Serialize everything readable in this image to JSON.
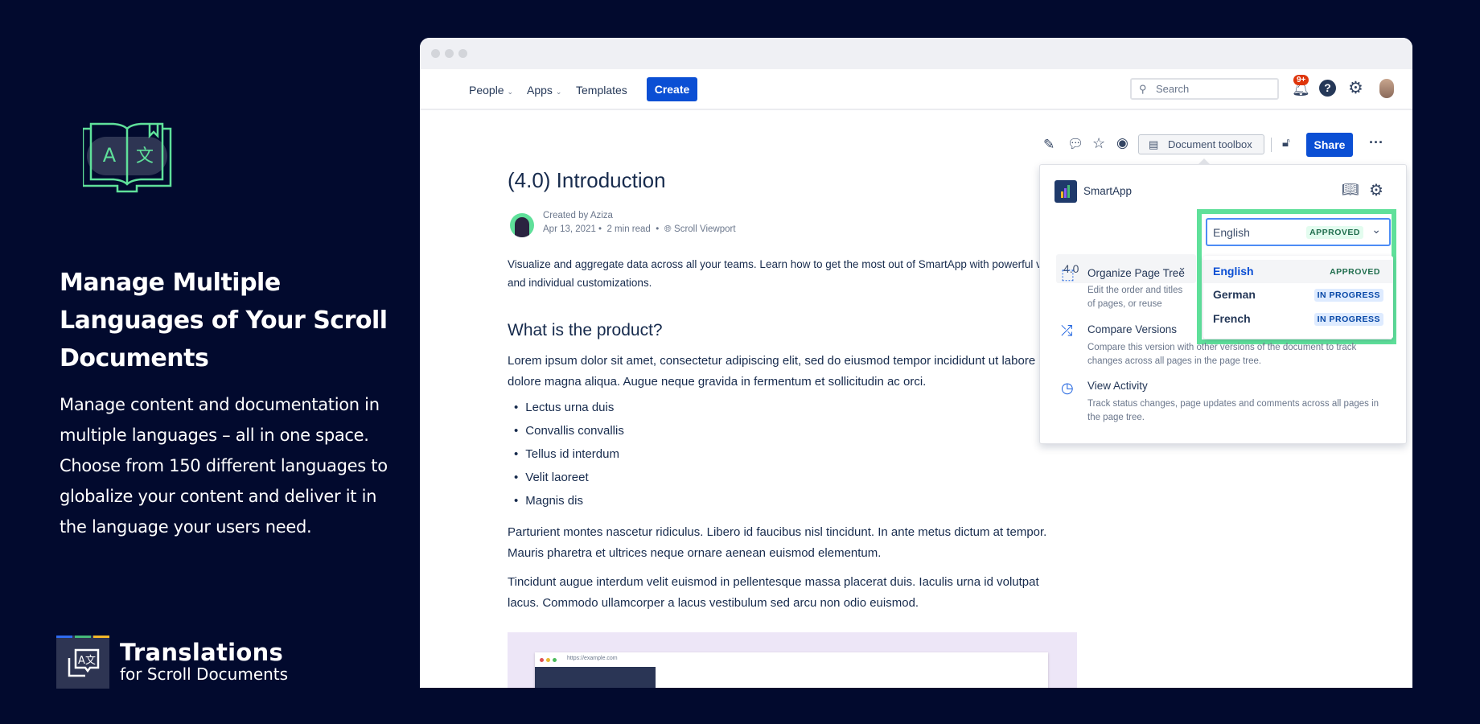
{
  "hero": {
    "heading": "Manage Multiple Languages of Your Scroll Documents",
    "body": "Manage content and documentation in multiple languages – all in one space. Choose from 150 different languages to globalize your content and deliver it in the language your users need."
  },
  "brand": {
    "title": "Translations",
    "subtitle": "for Scroll Documents",
    "icon_text": "A文",
    "colors": [
      "#2f6bf0",
      "#45b979",
      "#f5b829"
    ]
  },
  "nav": {
    "people": "People",
    "apps": "Apps",
    "templates": "Templates",
    "create": "Create",
    "search_placeholder": "Search",
    "notif_badge": "9+"
  },
  "toolbar": {
    "doc_toolbox": "Document toolbox",
    "share": "Share"
  },
  "doc": {
    "title": "(4.0) Introduction",
    "created_by": "Created by Aziza",
    "date": "Apr 13, 2021 •",
    "read": "2 min read",
    "sep": "•",
    "space": "Scroll Viewport",
    "intro": "Visualize and aggregate data across all your teams. Learn how to get the most out of SmartApp with powerful v and individual customizations.",
    "h2": "What is the product?",
    "p1": "Lorem ipsum dolor sit amet, consectetur adipiscing elit, sed do eiusmod tempor incididunt ut labore dolore magna aliqua. Augue neque gravida in fermentum et sollicitudin ac orci.",
    "bullets": [
      "Lectus urna duis",
      "Convallis convallis",
      "Tellus id interdum",
      "Velit laoreet",
      "Magnis dis"
    ],
    "p2": "Parturient montes nascetur ridiculus. Libero id faucibus nisl tincidunt. In ante metus dictum at tempor. Mauris pharetra et ultrices neque ornare aenean euismod elementum.",
    "p3": "Tincidunt augue interdum velit euismod in pellentesque massa placerat duis. Iaculis urna id volutpat lacus. Commodo ullamcorper a lacus vestibulum sed arcu non odio euismod.",
    "url": "https://example.com"
  },
  "popover": {
    "app": "SmartApp",
    "version": "4.0",
    "language": "English",
    "language_status": "APPROVED",
    "options": [
      {
        "label": "English",
        "status": "APPROVED"
      },
      {
        "label": "German",
        "status": "IN PROGRESS"
      },
      {
        "label": "French",
        "status": "IN PROGRESS"
      }
    ],
    "items": [
      {
        "title": "Organize Page Tree",
        "desc": "Edit the order and titles of pages, or reuse content from existing pages."
      },
      {
        "title": "Compare Versions",
        "desc": "Compare this version with other versions of the document to track changes across all pages in the page tree."
      },
      {
        "title": "View Activity",
        "desc": "Track status changes, page updates and comments across all pages in the page tree."
      }
    ]
  }
}
